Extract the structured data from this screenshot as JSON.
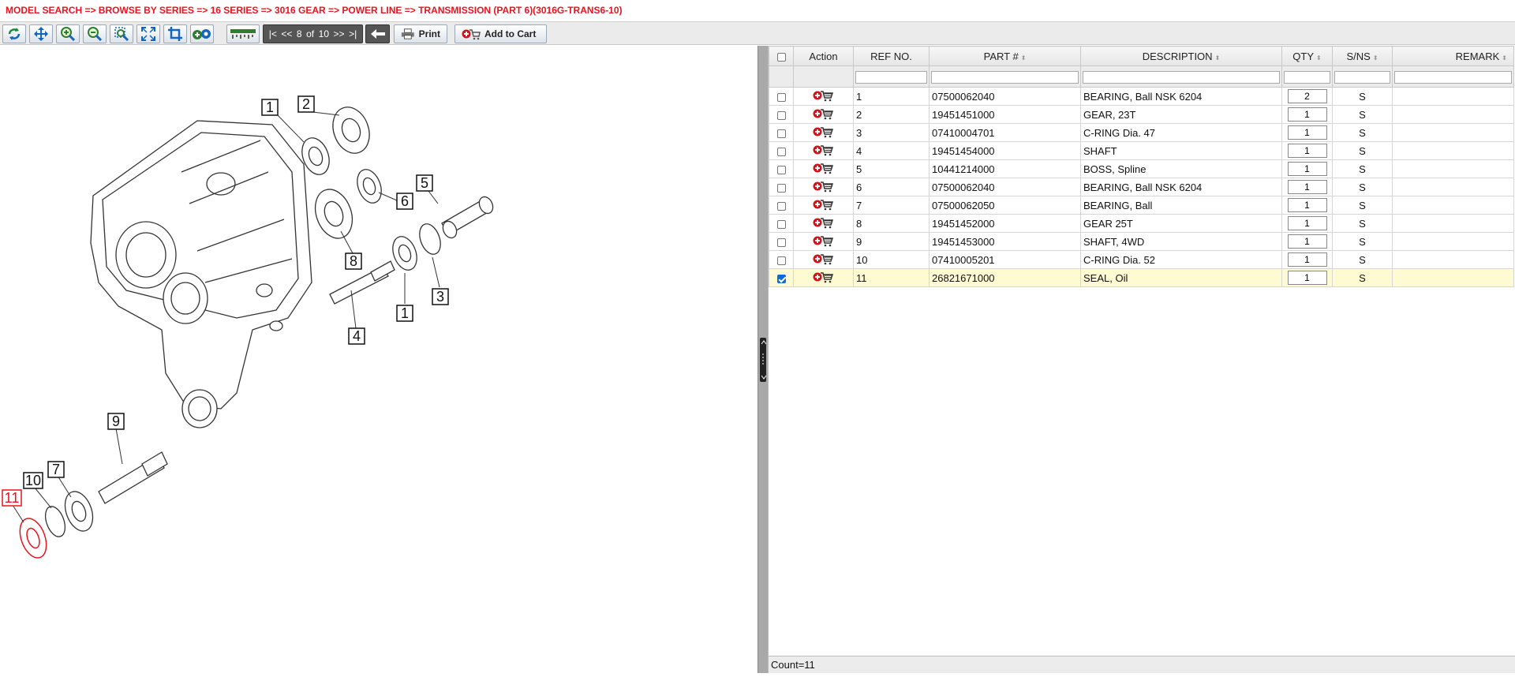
{
  "breadcrumb": "MODEL SEARCH  => BROWSE BY SERIES  => 16 SERIES  => 3016 GEAR  => POWER LINE  => TRANSMISSION (PART 6)(3016G-TRANS6-10)",
  "toolbar": {
    "icons": [
      "refresh-icon",
      "move-icon",
      "zoom-in-icon",
      "zoom-out-icon",
      "zoom-area-icon",
      "fit-icon",
      "crop-icon",
      "settings-icon",
      "ruler-icon"
    ],
    "pager": {
      "first": "|<",
      "prev": "<<",
      "current": "8",
      "of": "of",
      "total": "10",
      "next": ">>",
      "last": ">|"
    },
    "print_label": "Print",
    "add_to_cart_label": "Add to Cart"
  },
  "table": {
    "columns": [
      "Action",
      "REF NO.",
      "PART #",
      "DESCRIPTION",
      "QTY",
      "S/NS",
      "REMARK"
    ],
    "rows": [
      {
        "ref": "1",
        "part": "07500062040",
        "desc": "BEARING, Ball NSK 6204",
        "qty": "2",
        "sns": "S",
        "remark": "",
        "checked": false
      },
      {
        "ref": "2",
        "part": "19451451000",
        "desc": "GEAR, 23T",
        "qty": "1",
        "sns": "S",
        "remark": "",
        "checked": false
      },
      {
        "ref": "3",
        "part": "07410004701",
        "desc": "C-RING Dia. 47",
        "qty": "1",
        "sns": "S",
        "remark": "",
        "checked": false
      },
      {
        "ref": "4",
        "part": "19451454000",
        "desc": "SHAFT",
        "qty": "1",
        "sns": "S",
        "remark": "",
        "checked": false
      },
      {
        "ref": "5",
        "part": "10441214000",
        "desc": "BOSS, Spline",
        "qty": "1",
        "sns": "S",
        "remark": "",
        "checked": false
      },
      {
        "ref": "6",
        "part": "07500062040",
        "desc": "BEARING, Ball NSK 6204",
        "qty": "1",
        "sns": "S",
        "remark": "",
        "checked": false
      },
      {
        "ref": "7",
        "part": "07500062050",
        "desc": "BEARING, Ball",
        "qty": "1",
        "sns": "S",
        "remark": "",
        "checked": false
      },
      {
        "ref": "8",
        "part": "19451452000",
        "desc": "GEAR 25T",
        "qty": "1",
        "sns": "S",
        "remark": "",
        "checked": false
      },
      {
        "ref": "9",
        "part": "19451453000",
        "desc": "SHAFT, 4WD",
        "qty": "1",
        "sns": "S",
        "remark": "",
        "checked": false
      },
      {
        "ref": "10",
        "part": "07410005201",
        "desc": "C-RING Dia. 52",
        "qty": "1",
        "sns": "S",
        "remark": "",
        "checked": false
      },
      {
        "ref": "11",
        "part": "26821671000",
        "desc": "SEAL, Oil",
        "qty": "1",
        "sns": "S",
        "remark": "",
        "checked": true
      }
    ],
    "count_text": "Count=11"
  },
  "diagram": {
    "callouts": [
      "1",
      "2",
      "6",
      "5",
      "8",
      "1",
      "3",
      "4",
      "9",
      "7",
      "10",
      "11"
    ],
    "highlighted": "11"
  },
  "colors": {
    "breadcrumb": "#e8141e",
    "selected_row": "#fefbd3",
    "highlight": "#e8141e"
  }
}
